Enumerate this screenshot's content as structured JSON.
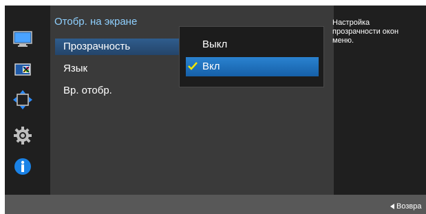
{
  "menu": {
    "title": "Отобр. на экране",
    "items": [
      {
        "label": "Прозрачность",
        "selected": true
      },
      {
        "label": "Язык",
        "selected": false
      },
      {
        "label": "Вр. отобр.",
        "selected": false
      }
    ]
  },
  "dropdown": {
    "options": [
      {
        "label": "Выкл",
        "checked": false
      },
      {
        "label": "Вкл",
        "checked": true
      }
    ]
  },
  "help": {
    "lines": [
      "Настройка",
      "прозрачности окон",
      "меню."
    ]
  },
  "footer": {
    "back_label": "Возвра"
  },
  "sidebar_icons": [
    "monitor-icon",
    "color-icon",
    "size-position-icon",
    "setup-gear-icon",
    "info-icon"
  ],
  "colors": {
    "accent": "#8fd0ff",
    "selected_blue": "#1a73c2",
    "check": "#f2e600"
  }
}
